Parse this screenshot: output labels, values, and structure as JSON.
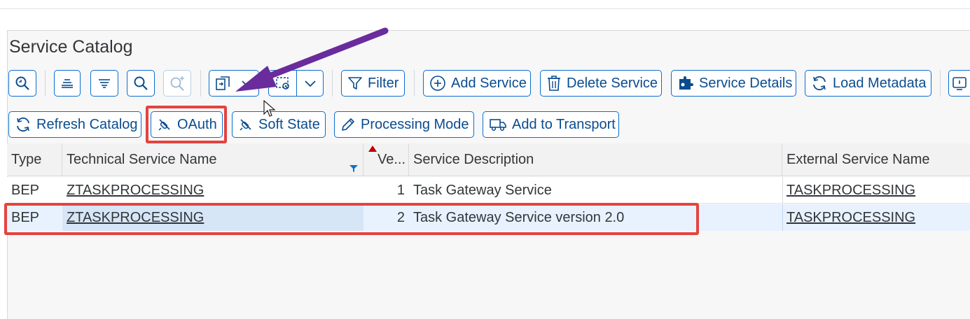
{
  "page": {
    "title": "Service Catalog"
  },
  "toolbar_row1": {
    "buttons": [
      {
        "name": "zoom-in-button",
        "icon": "zoom-in-icon"
      },
      {
        "name": "align-button",
        "icon": "align-justify-icon"
      },
      {
        "name": "align-center-button",
        "icon": "align-center-icon"
      },
      {
        "name": "search-button",
        "icon": "search-icon"
      },
      {
        "name": "search-add-button",
        "icon": "search-plus-icon",
        "disabled": true
      },
      {
        "name": "export-menu-button",
        "icon": "export-icon"
      },
      {
        "name": "settings-menu-button",
        "icon": "table-settings-icon"
      }
    ],
    "filter_label": "Filter",
    "add_service_label": "Add Service",
    "delete_service_label": "Delete Service",
    "service_details_label": "Service Details",
    "load_metadata_label": "Load Metadata"
  },
  "toolbar_row2": {
    "refresh_catalog_label": "Refresh Catalog",
    "oauth_label": "OAuth",
    "soft_state_label": "Soft State",
    "processing_mode_label": "Processing Mode",
    "add_to_transport_label": "Add to Transport"
  },
  "table": {
    "columns": {
      "type": "Type",
      "technical_name": "Technical Service Name",
      "version": "Ve...",
      "description": "Service Description",
      "external_name": "External Service Name"
    },
    "rows": [
      {
        "type": "BEP",
        "technical_name": "ZTASKPROCESSING",
        "version": "1",
        "description": "Task Gateway Service",
        "external_name": "TASKPROCESSING"
      },
      {
        "type": "BEP",
        "technical_name": "ZTASKPROCESSING",
        "version": "2",
        "description": "Task Gateway Service version 2.0",
        "external_name": "TASKPROCESSING"
      }
    ]
  },
  "colors": {
    "accent": "#0a6ed1",
    "highlight": "#e5433f",
    "arrow": "#6a2b9c",
    "selected_row": "#e8f2ff"
  }
}
